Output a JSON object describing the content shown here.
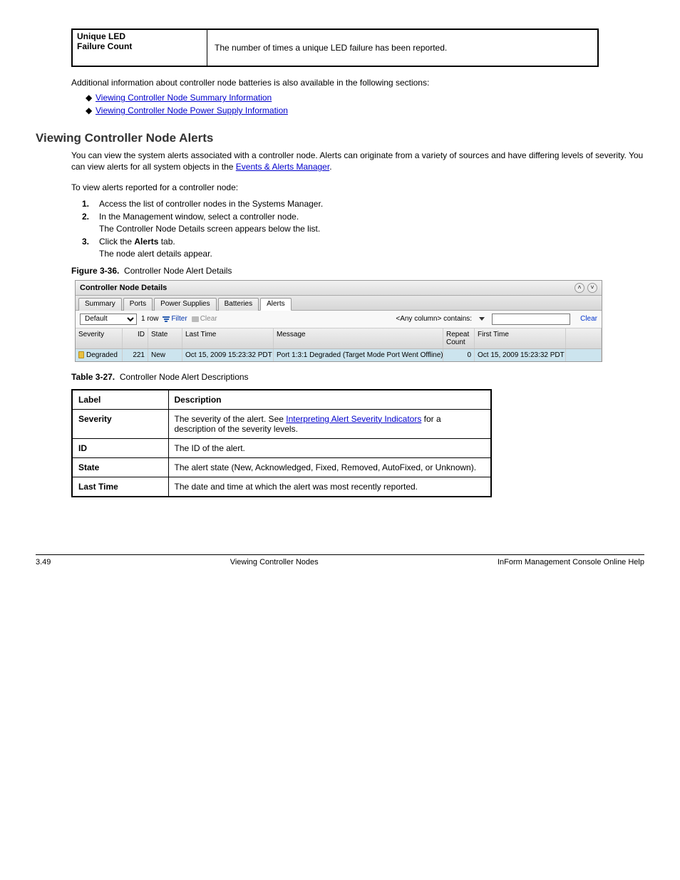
{
  "meta_table": {
    "left_label": "Unique LED\nFailure Count",
    "right_text": "The number of times a unique LED failure has been reported."
  },
  "additional_info_intro": "Additional information about controller node batteries is also available in the following sections:",
  "additional_info_links": [
    "Viewing Controller Node Summary Information",
    "Viewing Controller Node Power Supply Information"
  ],
  "section_title": "Viewing Controller Node Alerts",
  "section_para_1": "You can view the system alerts associated with a controller node.  Alerts can originate from a variety of sources and have differing levels of severity.  You can view alerts for all system objects in the",
  "section_para_1_link": "Events & Alerts Manager",
  "section_para_1_tail": ".",
  "steps_intro": "To view alerts reported for a controller node:",
  "steps": [
    {
      "num": "1.",
      "text": "Access the list of controller nodes in the Systems Manager."
    },
    {
      "num": "2.",
      "text_pre": "In the Management window, select a controller node.",
      "sub": "The Controller Node Details screen appears below the list."
    },
    {
      "num": "3.",
      "text_pre": "Click the ",
      "bold": "Alerts",
      "text_post": " tab.",
      "sub": "The node alert details appear."
    }
  ],
  "figure_caption": "Figure 3-36.  Controller Node Alert Details",
  "panel": {
    "title": "Controller Node Details",
    "tabs": [
      "Summary",
      "Ports",
      "Power Supplies",
      "Batteries",
      "Alerts"
    ],
    "active_tab": 4,
    "select_value": "Default",
    "row_count": "1 row",
    "filter_label": "Filter",
    "clear_gray": "Clear",
    "contains_label": "<Any column> contains:",
    "clear_link": "Clear",
    "columns": [
      "Severity",
      "ID",
      "State",
      "Last Time",
      "Message",
      "Repeat\nCount",
      "First Time",
      ""
    ],
    "row": {
      "severity": "Degraded",
      "id": "221",
      "state": "New",
      "last_time": "Oct 15, 2009 15:23:32 PDT",
      "message": "Port 1:3:1 Degraded (Target Mode Port Went Offline)",
      "repeat": "0",
      "first_time": "Oct 15, 2009 15:23:32 PDT"
    }
  },
  "desc_table_caption": "Table 3-27.  Controller Node Alert Descriptions",
  "desc_table_headers": [
    "Label",
    "Description"
  ],
  "desc_table_rows": [
    {
      "label": "Severity",
      "desc_pre": "The severity of the alert.  See ",
      "desc_link": "Interpreting Alert Severity Indicators",
      "desc_post": " for a description of the severity levels."
    },
    {
      "label": "ID",
      "desc": "The ID of the alert."
    },
    {
      "label": "State",
      "desc": "The alert state (New, Acknowledged, Fixed, Removed, AutoFixed, or Unknown)."
    },
    {
      "label": "Last Time",
      "desc": "The date and time at which the alert was most recently reported."
    }
  ],
  "footer": {
    "left": "3.49",
    "center": "Viewing Controller Nodes",
    "right": "InForm Management Console Online Help"
  }
}
